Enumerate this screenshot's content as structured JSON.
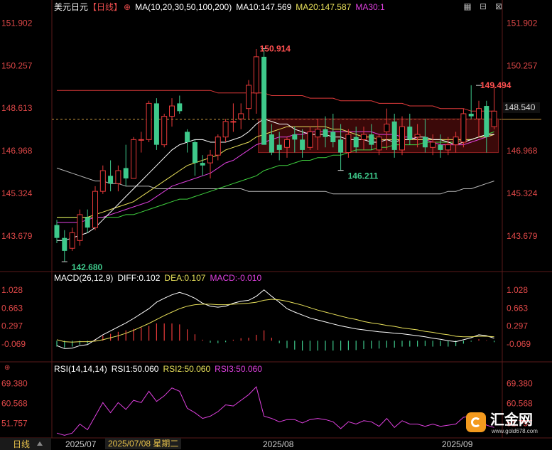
{
  "header": {
    "symbol": "美元日元",
    "period": "【日线】",
    "ma_label": "MA(10,20,30,50,100,200)",
    "ma10": "MA10:147.569",
    "ma20": "MA20:147.587",
    "ma30": "MA30:1"
  },
  "macd_header": {
    "label": "MACD(26,12,9)",
    "diff": "DIFF:0.102",
    "dea": "DEA:0.107",
    "macd": "MACD:-0.010"
  },
  "rsi_header": {
    "label": "RSI(14,14,14)",
    "rsi1": "RSI1:50.060",
    "rsi2": "RSI2:50.060",
    "rsi3": "RSI3:50.060"
  },
  "footer": {
    "period_button": "日线",
    "date1": "2025/07",
    "date_selected": "2025/07/08 星期二",
    "date2": "2025/08",
    "date3": "2025/09"
  },
  "current_price": "148.540",
  "watermark": {
    "brand": "汇金网",
    "url": "www.gold678.com"
  },
  "colors": {
    "up": "#e83a3a",
    "down": "#3ec98b",
    "ma10": "#ffffff",
    "ma20": "#e8e05a",
    "ma30": "#e040e0",
    "ma50": "#3fd13f",
    "ma100": "#e03a3a",
    "ma200": "#b8b8b8",
    "axis_text": "#e04848"
  },
  "chart_data": [
    {
      "type": "candlestick",
      "title": "美元日元【日线】",
      "y_ticks": [
        "151.902",
        "150.257",
        "148.613",
        "146.968",
        "145.324",
        "143.679"
      ],
      "ylim": [
        142.3,
        152.3
      ],
      "x_ticks": [
        "2025/07",
        "2025/08",
        "2025/09"
      ],
      "annotations": [
        {
          "text": "150.914",
          "value": 150.914
        },
        {
          "text": "149.494",
          "value": 149.494
        },
        {
          "text": "146.211",
          "value": 146.211
        },
        {
          "text": "142.680",
          "value": 142.68
        }
      ],
      "candles": [
        [
          144.1,
          144.3,
          143.4,
          143.6
        ],
        [
          143.6,
          143.9,
          142.7,
          143.1
        ],
        [
          143.2,
          144.0,
          143.1,
          143.8
        ],
        [
          143.5,
          144.7,
          143.3,
          144.5
        ],
        [
          144.4,
          144.7,
          143.8,
          144.0
        ],
        [
          144.0,
          145.6,
          143.9,
          145.4
        ],
        [
          145.4,
          146.4,
          145.3,
          146.2
        ],
        [
          146.0,
          146.6,
          145.4,
          145.7
        ],
        [
          145.7,
          146.4,
          145.4,
          146.2
        ],
        [
          146.3,
          147.2,
          145.6,
          145.9
        ],
        [
          145.9,
          147.5,
          145.9,
          147.4
        ],
        [
          147.4,
          147.7,
          146.9,
          147.4
        ],
        [
          147.4,
          148.9,
          147.3,
          148.8
        ],
        [
          148.8,
          149.0,
          147.0,
          147.2
        ],
        [
          147.2,
          148.4,
          147.1,
          148.3
        ],
        [
          148.3,
          149.0,
          147.9,
          148.7
        ],
        [
          148.8,
          149.1,
          148.4,
          148.5
        ],
        [
          147.7,
          147.8,
          146.9,
          147.3
        ],
        [
          147.3,
          147.4,
          146.0,
          146.5
        ],
        [
          146.5,
          146.8,
          146.0,
          146.4
        ],
        [
          146.5,
          147.0,
          145.9,
          146.8
        ],
        [
          146.8,
          147.6,
          146.6,
          147.5
        ],
        [
          147.5,
          148.2,
          147.3,
          148.1
        ],
        [
          148.1,
          148.8,
          147.7,
          148.1
        ],
        [
          148.2,
          148.8,
          147.8,
          148.4
        ],
        [
          148.6,
          149.7,
          148.2,
          149.5
        ],
        [
          149.2,
          150.9,
          148.4,
          150.6
        ],
        [
          150.6,
          150.9,
          147.2,
          147.2
        ],
        [
          147.6,
          148.0,
          146.8,
          146.9
        ],
        [
          147.2,
          147.7,
          146.6,
          147.0
        ],
        [
          147.1,
          147.5,
          146.7,
          147.4
        ],
        [
          147.6,
          147.9,
          146.9,
          147.4
        ],
        [
          147.4,
          147.8,
          146.7,
          147.0
        ],
        [
          147.1,
          147.9,
          147.0,
          147.7
        ],
        [
          147.5,
          148.2,
          147.0,
          147.8
        ],
        [
          147.8,
          148.3,
          147.1,
          147.5
        ],
        [
          147.7,
          148.4,
          147.1,
          147.3
        ],
        [
          147.4,
          148.0,
          146.2,
          146.9
        ],
        [
          146.9,
          147.8,
          146.7,
          147.6
        ],
        [
          147.5,
          147.9,
          146.9,
          147.1
        ],
        [
          147.4,
          147.9,
          147.0,
          147.6
        ],
        [
          147.6,
          148.0,
          147.0,
          147.2
        ],
        [
          147.0,
          147.6,
          146.8,
          147.5
        ],
        [
          147.7,
          148.6,
          147.0,
          148.0
        ],
        [
          148.1,
          148.4,
          146.7,
          147.0
        ],
        [
          147.0,
          148.3,
          146.8,
          147.9
        ],
        [
          147.9,
          148.4,
          147.2,
          147.4
        ],
        [
          147.5,
          148.0,
          147.1,
          147.6
        ],
        [
          147.5,
          148.2,
          146.9,
          147.1
        ],
        [
          147.1,
          147.6,
          146.8,
          147.3
        ],
        [
          147.2,
          147.6,
          146.7,
          147.0
        ],
        [
          147.0,
          147.5,
          146.8,
          147.2
        ],
        [
          147.2,
          147.7,
          146.9,
          147.5
        ],
        [
          147.3,
          148.6,
          147.1,
          148.4
        ],
        [
          148.4,
          149.5,
          148.2,
          148.3
        ],
        [
          148.2,
          148.9,
          147.5,
          148.6
        ],
        [
          148.7,
          148.9,
          146.9,
          147.5
        ],
        [
          147.9,
          149.5,
          147.8,
          148.5
        ]
      ],
      "ma10": [
        143.5,
        143.5,
        143.6,
        143.7,
        143.8,
        144.0,
        144.3,
        144.6,
        144.9,
        145.2,
        145.5,
        145.8,
        146.1,
        146.4,
        146.7,
        147.0,
        147.2,
        147.3,
        147.4,
        147.4,
        147.3,
        147.3,
        147.3,
        147.4,
        147.5,
        147.7,
        148.0,
        148.2,
        148.1,
        148.0,
        148.0,
        147.8,
        147.7,
        147.6,
        147.6,
        147.6,
        147.5,
        147.5,
        147.4,
        147.4,
        147.4,
        147.3,
        147.3,
        147.4,
        147.3,
        147.4,
        147.4,
        147.5,
        147.5,
        147.4,
        147.4,
        147.3,
        147.2,
        147.3,
        147.4,
        147.5,
        147.6,
        147.6
      ],
      "ma20": [
        144.4,
        144.4,
        144.4,
        144.4,
        144.4,
        144.5,
        144.6,
        144.7,
        144.8,
        144.9,
        145.0,
        145.2,
        145.4,
        145.6,
        145.8,
        146.0,
        146.2,
        146.4,
        146.5,
        146.6,
        146.7,
        146.8,
        147.0,
        147.1,
        147.2,
        147.3,
        147.5,
        147.6,
        147.7,
        147.8,
        147.9,
        147.9,
        147.9,
        147.9,
        147.9,
        147.9,
        147.8,
        147.8,
        147.7,
        147.6,
        147.5,
        147.5,
        147.4,
        147.4,
        147.4,
        147.4,
        147.4,
        147.4,
        147.4,
        147.4,
        147.4,
        147.4,
        147.4,
        147.4,
        147.4,
        147.5,
        147.5,
        147.6
      ],
      "ma30": [
        144.2,
        144.2,
        144.2,
        144.2,
        144.3,
        144.4,
        144.4,
        144.5,
        144.6,
        144.7,
        144.8,
        144.9,
        145.0,
        145.2,
        145.4,
        145.6,
        145.7,
        145.8,
        145.9,
        146.0,
        146.1,
        146.3,
        146.5,
        146.6,
        146.8,
        147.0,
        147.2,
        147.3,
        147.4,
        147.5,
        147.5,
        147.6,
        147.6,
        147.7,
        147.7,
        147.7,
        147.7,
        147.7,
        147.7,
        147.7,
        147.7,
        147.7,
        147.6,
        147.6,
        147.6,
        147.5,
        147.5,
        147.4,
        147.4,
        147.3,
        147.2,
        147.2,
        147.2,
        147.2,
        147.3,
        147.4,
        147.5,
        147.6
      ],
      "ma50": [
        144.4,
        144.4,
        144.4,
        144.4,
        144.4,
        144.4,
        144.4,
        144.4,
        144.4,
        144.5,
        144.5,
        144.6,
        144.7,
        144.8,
        144.9,
        145.0,
        145.1,
        145.1,
        145.2,
        145.3,
        145.4,
        145.5,
        145.6,
        145.7,
        145.8,
        145.9,
        146.0,
        146.2,
        146.3,
        146.4,
        146.4,
        146.5,
        146.6,
        146.6,
        146.7,
        146.7,
        146.8,
        146.8,
        146.9,
        147.0,
        147.0,
        147.0,
        147.1,
        147.1,
        147.2,
        147.2,
        147.2,
        147.2,
        147.3,
        147.3,
        147.3,
        147.3,
        147.3,
        147.4,
        147.4,
        147.5,
        147.6,
        147.7
      ],
      "ma100": [
        149.3,
        149.3,
        149.3,
        149.3,
        149.3,
        149.3,
        149.3,
        149.3,
        149.3,
        149.3,
        149.3,
        149.3,
        149.3,
        149.3,
        149.3,
        149.3,
        149.3,
        149.3,
        149.3,
        149.3,
        149.3,
        149.2,
        149.2,
        149.2,
        149.2,
        149.2,
        149.2,
        149.2,
        149.1,
        149.1,
        149.1,
        149.1,
        149.1,
        149.0,
        149.0,
        149.0,
        149.0,
        148.9,
        148.9,
        148.9,
        148.9,
        148.9,
        148.8,
        148.8,
        148.8,
        148.8,
        148.7,
        148.7,
        148.7,
        148.7,
        148.6,
        148.6,
        148.6,
        148.6,
        148.5,
        148.5,
        148.5,
        148.5
      ],
      "ma200": [
        146.3,
        146.2,
        146.1,
        146.0,
        145.9,
        145.8,
        145.8,
        145.7,
        145.7,
        145.6,
        145.6,
        145.6,
        145.6,
        145.5,
        145.5,
        145.5,
        145.5,
        145.5,
        145.5,
        145.5,
        145.5,
        145.5,
        145.5,
        145.5,
        145.5,
        145.4,
        145.4,
        145.4,
        145.4,
        145.4,
        145.4,
        145.4,
        145.4,
        145.4,
        145.4,
        145.4,
        145.3,
        145.3,
        145.3,
        145.3,
        145.3,
        145.3,
        145.3,
        145.3,
        145.3,
        145.3,
        145.3,
        145.3,
        145.3,
        145.3,
        145.3,
        145.4,
        145.4,
        145.5,
        145.5,
        145.6,
        145.7,
        145.8
      ],
      "box": {
        "x_from_index": 27,
        "x_to_index": 57,
        "y_from": 146.9,
        "y_to": 148.2
      },
      "current_price": 148.54
    },
    {
      "type": "macd",
      "y_ticks": [
        "1.028",
        "0.663",
        "0.297",
        "-0.069"
      ],
      "ylim": [
        -0.4,
        1.2
      ],
      "diff": [
        -0.1,
        -0.16,
        -0.15,
        -0.1,
        -0.08,
        0.02,
        0.12,
        0.2,
        0.28,
        0.36,
        0.45,
        0.55,
        0.65,
        0.78,
        0.86,
        0.93,
        0.98,
        0.93,
        0.86,
        0.76,
        0.7,
        0.68,
        0.7,
        0.76,
        0.8,
        0.82,
        0.9,
        1.03,
        0.9,
        0.78,
        0.65,
        0.58,
        0.52,
        0.46,
        0.42,
        0.38,
        0.34,
        0.3,
        0.27,
        0.24,
        0.22,
        0.2,
        0.18,
        0.17,
        0.15,
        0.14,
        0.12,
        0.1,
        0.08,
        0.05,
        0.03,
        0.0,
        -0.02,
        0.02,
        0.06,
        0.12,
        0.1,
        0.05
      ],
      "dea": [
        0.02,
        -0.02,
        -0.03,
        -0.02,
        -0.02,
        -0.01,
        0.02,
        0.06,
        0.1,
        0.15,
        0.21,
        0.28,
        0.35,
        0.43,
        0.51,
        0.58,
        0.65,
        0.7,
        0.73,
        0.74,
        0.74,
        0.73,
        0.73,
        0.74,
        0.75,
        0.76,
        0.78,
        0.82,
        0.84,
        0.83,
        0.8,
        0.76,
        0.72,
        0.67,
        0.62,
        0.58,
        0.54,
        0.5,
        0.46,
        0.43,
        0.39,
        0.36,
        0.34,
        0.31,
        0.29,
        0.26,
        0.24,
        0.22,
        0.19,
        0.17,
        0.14,
        0.12,
        0.09,
        0.08,
        0.08,
        0.09,
        0.09,
        0.08
      ],
      "macd": [
        -0.12,
        -0.14,
        -0.12,
        -0.08,
        -0.06,
        0.03,
        0.1,
        0.14,
        0.18,
        0.21,
        0.24,
        0.27,
        0.3,
        0.35,
        0.35,
        0.35,
        0.33,
        0.23,
        0.13,
        0.02,
        -0.04,
        -0.05,
        -0.03,
        0.02,
        0.05,
        0.06,
        0.12,
        0.21,
        0.06,
        -0.05,
        -0.15,
        -0.18,
        -0.2,
        -0.21,
        -0.2,
        -0.2,
        -0.2,
        -0.2,
        -0.19,
        -0.19,
        -0.17,
        -0.16,
        -0.16,
        -0.14,
        -0.14,
        -0.12,
        -0.12,
        -0.12,
        -0.11,
        -0.12,
        -0.11,
        -0.12,
        -0.11,
        -0.06,
        -0.02,
        0.03,
        0.01,
        -0.03
      ]
    },
    {
      "type": "line",
      "y_ticks": [
        "69.380",
        "60.568",
        "51.757"
      ],
      "ylim": [
        46,
        74
      ],
      "rsi": [
        47.5,
        46.5,
        47.5,
        51.5,
        49.0,
        55.0,
        61.0,
        56.5,
        61.0,
        58.0,
        62.0,
        61.0,
        66.0,
        61.5,
        64.0,
        67.5,
        66.0,
        58.5,
        56.5,
        54.0,
        55.0,
        57.0,
        60.0,
        59.5,
        62.0,
        64.5,
        68.0,
        55.0,
        54.0,
        52.5,
        53.5,
        53.5,
        52.0,
        53.5,
        54.0,
        53.5,
        52.5,
        49.5,
        52.5,
        51.5,
        53.0,
        52.5,
        50.5,
        54.0,
        50.0,
        53.0,
        51.5,
        51.5,
        50.5,
        51.5,
        50.5,
        51.0,
        51.5,
        54.5,
        55.0,
        55.5,
        51.0,
        50.0
      ]
    }
  ]
}
